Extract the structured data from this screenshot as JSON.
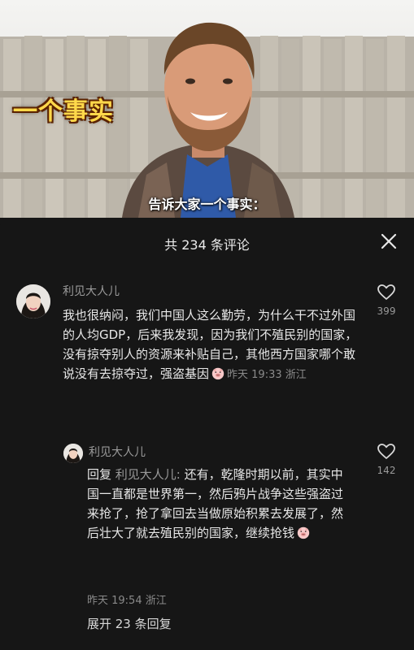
{
  "video": {
    "overlay_title": "一个事实",
    "subtitle": "告诉大家一个事实："
  },
  "comments_panel": {
    "title": "共 234 条评论",
    "close_icon": "close-icon"
  },
  "comments": [
    {
      "username": "利见大人儿",
      "text": "我也很纳闷，我们中国人这么勤劳，为什么干不过外国的人均GDP，后来我发现，因为我们不殖民别的国家，没有掠夺别人的资源来补贴自己，其他西方国家哪个敢说没有去掠夺过，强盗基因",
      "emoji": "pig-face-emoji",
      "time": "昨天 19:33",
      "location": "浙江",
      "likes": "399"
    }
  ],
  "replies": [
    {
      "username": "利见大人儿",
      "reply_prefix": "回复",
      "reply_to": "利见大人儿:",
      "text": "还有，乾隆时期以前，其实中国一直都是世界第一，然后鸦片战争这些强盗过来抢了，抢了拿回去当做原始积累去发展了，然后壮大了就去殖民别的国家，继续抢钱",
      "emoji": "pig-face-emoji",
      "time": "昨天 19:54",
      "location": "浙江",
      "likes": "142"
    }
  ],
  "expand_replies": "展开 23 条回复"
}
